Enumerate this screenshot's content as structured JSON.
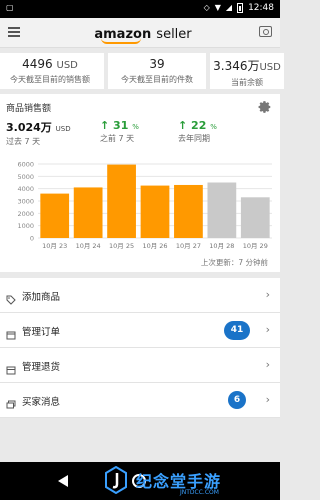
{
  "status_bar": {
    "time": "12:48"
  },
  "app_bar": {
    "logo_word1": "amazon",
    "logo_word2": "seller"
  },
  "stats": [
    {
      "value": "4496",
      "unit": "USD",
      "label": "今天截至目前的销售额"
    },
    {
      "value": "39",
      "unit": "",
      "label": "今天截至目前的件数"
    },
    {
      "value": "3.346万",
      "unit": "USD",
      "label": "当前余额"
    }
  ],
  "sales": {
    "title": "商品销售额",
    "total": "3.024万",
    "total_unit": "USD",
    "total_sub": "过去 7 天",
    "change1": "↑ 31",
    "change1_unit": "%",
    "change1_sub": "之前 7 天",
    "change2": "↑ 22",
    "change2_unit": "%",
    "change2_sub": "去年同期",
    "updated": "上次更新：7 分钟前"
  },
  "chart_data": {
    "type": "bar",
    "categories": [
      "10月 23",
      "10月 24",
      "10月 25",
      "10月 26",
      "10月 27",
      "10月 28",
      "10月 29"
    ],
    "values": [
      3600,
      4100,
      5950,
      4250,
      4300,
      4500,
      3300
    ],
    "bar_colors": [
      "#ff9900",
      "#ff9900",
      "#ff9900",
      "#ff9900",
      "#ff9900",
      "#c9c9c9",
      "#c9c9c9"
    ],
    "yticks": [
      0,
      1000,
      2000,
      3000,
      4000,
      5000,
      6000
    ],
    "ylim": [
      0,
      6000
    ],
    "grid": true
  },
  "list": [
    {
      "name": "add-product",
      "icon": "tag-icon",
      "label": "添加商品",
      "badge": ""
    },
    {
      "name": "manage-orders",
      "icon": "calendar-icon",
      "label": "管理订单",
      "badge": "41"
    },
    {
      "name": "manage-returns",
      "icon": "box-icon",
      "label": "管理退货",
      "badge": ""
    },
    {
      "name": "buyer-messages",
      "icon": "message-icon",
      "label": "买家消息",
      "badge": "6"
    }
  ],
  "watermark": {
    "text": "纪念堂手游",
    "url": "JNTDCC.COM"
  },
  "colors": {
    "accent": "#ff9900",
    "badge": "#1a73c8",
    "positive": "#2a9d3a"
  }
}
